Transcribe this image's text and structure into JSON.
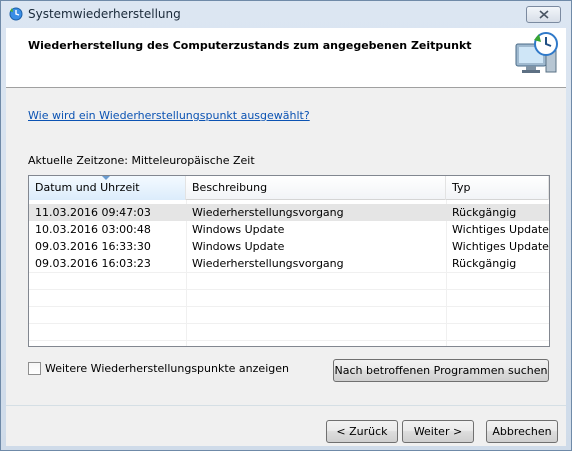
{
  "window": {
    "title": "Systemwiederherstellung"
  },
  "header": {
    "title": "Wiederherstellung des Computerzustands zum angegebenen Zeitpunkt",
    "icon": "system-restore-icon"
  },
  "help_link": "Wie wird ein Wiederherstellungspunkt ausgewählt?",
  "timezone_label": "Aktuelle Zeitzone: Mitteleuropäische Zeit",
  "table": {
    "columns": [
      "Datum und Uhrzeit",
      "Beschreibung",
      "Typ"
    ],
    "rows": [
      {
        "date": "11.03.2016 09:47:03",
        "description": "Wiederherstellungsvorgang",
        "type": "Rückgängig"
      },
      {
        "date": "10.03.2016 03:00:48",
        "description": "Windows Update",
        "type": "Wichtiges Update"
      },
      {
        "date": "09.03.2016 16:33:30",
        "description": "Windows Update",
        "type": "Wichtiges Update"
      },
      {
        "date": "09.03.2016 16:03:23",
        "description": "Wiederherstellungsvorgang",
        "type": "Rückgängig"
      }
    ],
    "selected_row": 0
  },
  "checkbox": {
    "label": "Weitere Wiederherstellungspunkte anzeigen",
    "checked": false
  },
  "buttons": {
    "scan": "Nach betroffenen Programmen suchen",
    "back": "< Zurück",
    "next": "Weiter >",
    "cancel": "Abbrechen"
  },
  "colors": {
    "link": "#0b53b3",
    "selected_row": "#e5e5e5"
  }
}
